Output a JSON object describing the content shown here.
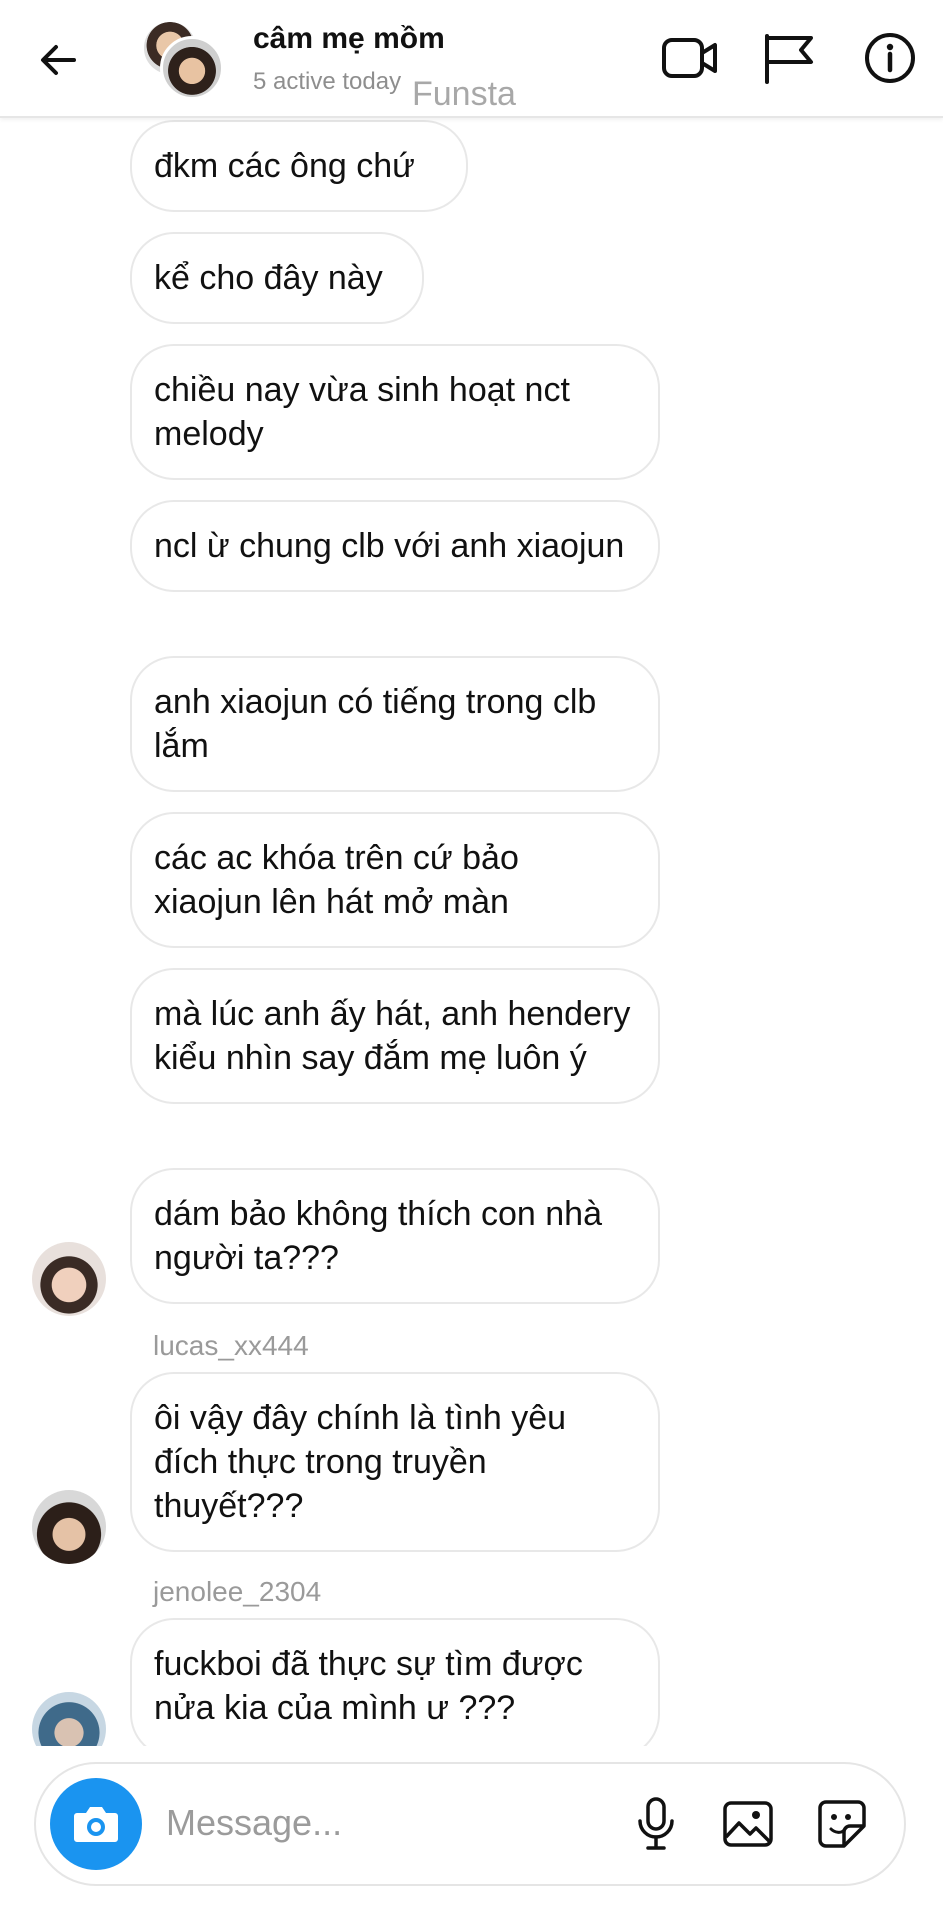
{
  "header": {
    "title": "câm mẹ mồm",
    "subtitle": "5 active today",
    "watermark": "Funsta"
  },
  "messages": [
    {
      "text": "đkm các ông chứ"
    },
    {
      "text": "kể cho đây này"
    },
    {
      "text": "chiều nay vừa sinh hoạt nct melody"
    },
    {
      "text": "ncl ừ chung clb với anh xiaojun"
    },
    {
      "text": "anh xiaojun có tiếng trong clb lắm"
    },
    {
      "text": "các ac khóa trên cứ bảo xiaojun lên hát mở màn"
    },
    {
      "text": "mà lúc anh ấy hát, anh hendery kiểu nhìn say đắm mẹ luôn ý"
    },
    {
      "text": "dám bảo không thích con nhà người ta???"
    },
    {
      "sender": "lucas_xx444",
      "text": "ôi vậy đây chính là tình yêu đích thực trong truyền thuyết???"
    },
    {
      "sender": "jenolee_2304",
      "text": "fuckboi đã thực sự tìm được nửa kia của mình ư ???"
    }
  ],
  "composer": {
    "placeholder": "Message..."
  }
}
